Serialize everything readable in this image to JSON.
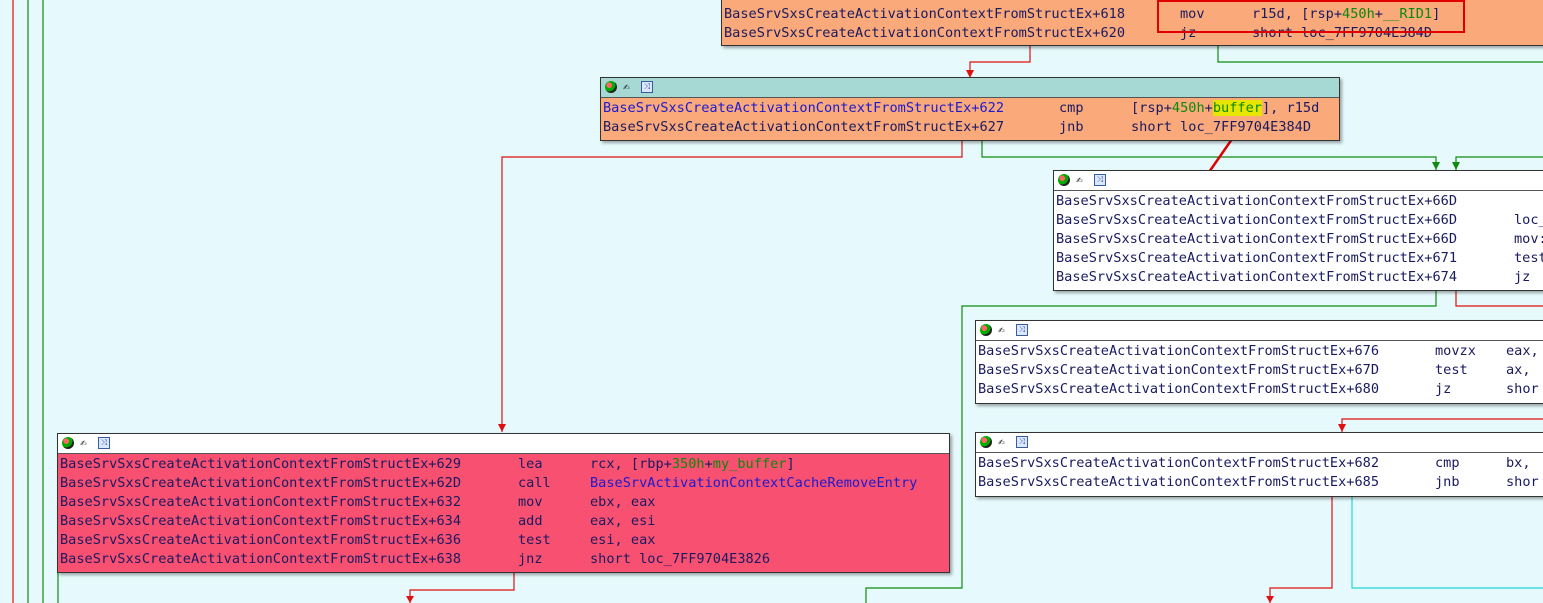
{
  "blocks": {
    "top": {
      "rows": [
        {
          "addr": "BaseSrvSxsCreateActivationContextFromStructEx+618",
          "mnem": "mov",
          "op_pre": "r15d, [rsp+",
          "op_num": "450h",
          "op_plus": "+",
          "op_var": "__RID1",
          "op_post": "]"
        },
        {
          "addr": "BaseSrvSxsCreateActivationContextFromStructEx+620",
          "mnem": "jz",
          "op": "short loc_7FF9704E384D"
        }
      ]
    },
    "b622": {
      "rows": [
        {
          "addr": "BaseSrvSxsCreateActivationContextFromStructEx+622",
          "mnem": "cmp",
          "op_pre": "[rsp+",
          "op_num": "450h",
          "op_plus": "+",
          "op_var": "buffer",
          "op_post": "], r15d"
        },
        {
          "addr": "BaseSrvSxsCreateActivationContextFromStructEx+627",
          "mnem": "jnb",
          "op": "short loc_7FF9704E384D"
        }
      ]
    },
    "b66d": {
      "rows": [
        {
          "addr": "BaseSrvSxsCreateActivationContextFromStructEx+66D",
          "mnem": ""
        },
        {
          "addr": "BaseSrvSxsCreateActivationContextFromStructEx+66D",
          "mnem": "loc_"
        },
        {
          "addr": "BaseSrvSxsCreateActivationContextFromStructEx+66D",
          "mnem": "mov:"
        },
        {
          "addr": "BaseSrvSxsCreateActivationContextFromStructEx+671",
          "mnem": "test"
        },
        {
          "addr": "BaseSrvSxsCreateActivationContextFromStructEx+674",
          "mnem": "jz"
        }
      ]
    },
    "b676": {
      "rows": [
        {
          "addr": "BaseSrvSxsCreateActivationContextFromStructEx+676",
          "mnem": "movzx",
          "op": "eax,"
        },
        {
          "addr": "BaseSrvSxsCreateActivationContextFromStructEx+67D",
          "mnem": "test",
          "op": "ax,"
        },
        {
          "addr": "BaseSrvSxsCreateActivationContextFromStructEx+680",
          "mnem": "jz",
          "op": "shor"
        }
      ]
    },
    "b682": {
      "rows": [
        {
          "addr": "BaseSrvSxsCreateActivationContextFromStructEx+682",
          "mnem": "cmp",
          "op": "bx,"
        },
        {
          "addr": "BaseSrvSxsCreateActivationContextFromStructEx+685",
          "mnem": "jnb",
          "op": "shor"
        }
      ]
    },
    "b629": {
      "rows": [
        {
          "addr": "BaseSrvSxsCreateActivationContextFromStructEx+629",
          "mnem": "lea",
          "op_pre": "rcx, [rbp+",
          "op_num": "350h",
          "op_plus": "+",
          "op_var": "my_buffer",
          "op_post": "]"
        },
        {
          "addr": "BaseSrvSxsCreateActivationContextFromStructEx+62D",
          "mnem": "call",
          "op": "BaseSrvActivationContextCacheRemoveEntry"
        },
        {
          "addr": "BaseSrvSxsCreateActivationContextFromStructEx+632",
          "mnem": "mov",
          "op": "ebx, eax"
        },
        {
          "addr": "BaseSrvSxsCreateActivationContextFromStructEx+634",
          "mnem": "add",
          "op": "eax, esi"
        },
        {
          "addr": "BaseSrvSxsCreateActivationContextFromStructEx+636",
          "mnem": "test",
          "op": "esi, eax"
        },
        {
          "addr": "BaseSrvSxsCreateActivationContextFromStructEx+638",
          "mnem": "jnz",
          "op": "short loc_7FF9704E3826"
        }
      ]
    }
  },
  "header_icons": [
    "graph-node-icon",
    "edit-icon",
    "flow-chart-icon"
  ],
  "colors": {
    "background": "#e6fafd",
    "orange_block": "#f9a97a",
    "red_block": "#f85070",
    "white_block": "#ffffff",
    "header_teal": "#a6d8d4",
    "edge_red": "#e01010",
    "edge_green": "#108a10",
    "edge_cyan": "#20d8e0",
    "annotation_red": "#e00000"
  }
}
